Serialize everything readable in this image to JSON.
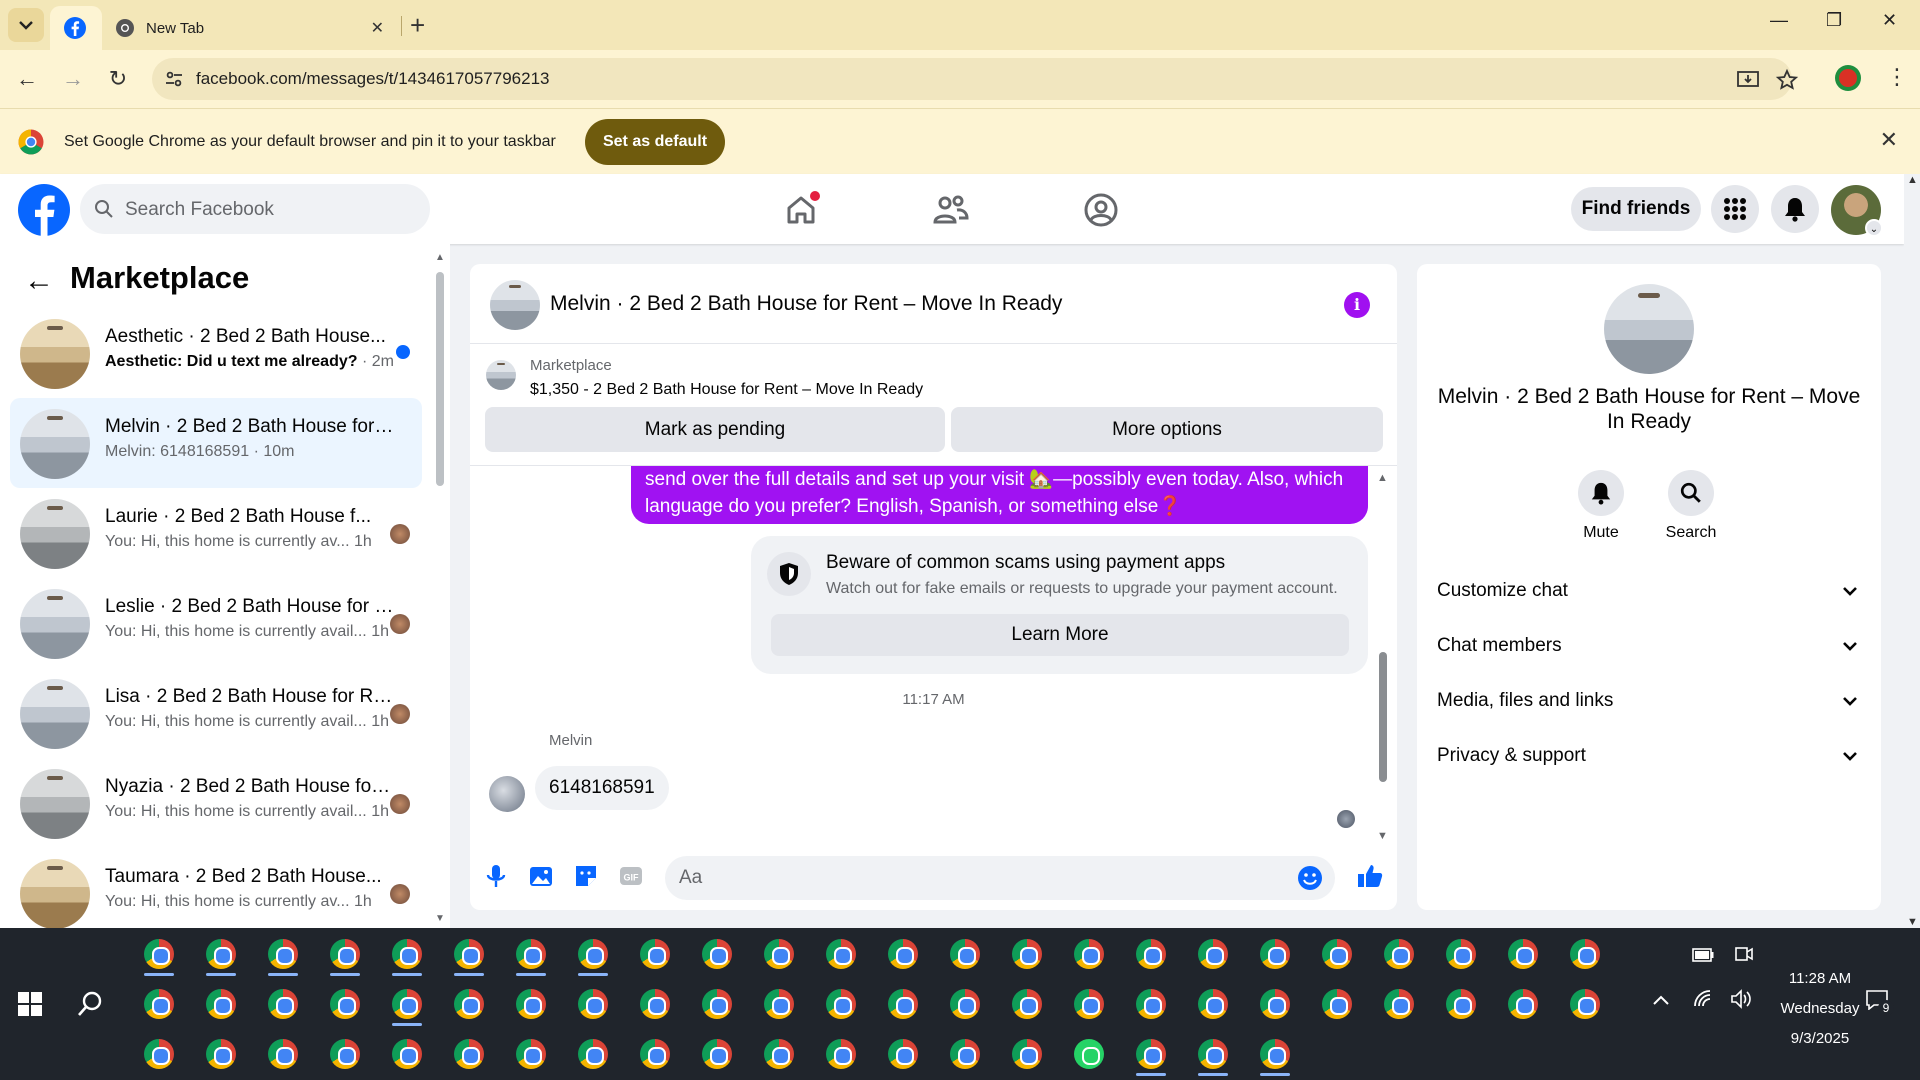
{
  "browser": {
    "tabs": [
      {
        "title": "",
        "icon": "facebook-icon",
        "active": true
      },
      {
        "title": "New Tab",
        "icon": "chrome-icon",
        "active": false
      }
    ],
    "url": "facebook.com/messages/t/1434617057796213",
    "infobar": {
      "message": "Set Google Chrome as your default browser and pin it to your taskbar",
      "button": "Set as default"
    }
  },
  "facebook": {
    "search_placeholder": "Search Facebook",
    "find_friends": "Find friends",
    "accent_color": "#a012f2",
    "brand_color": "#0866ff"
  },
  "marketplace": {
    "title": "Marketplace",
    "conversations": [
      {
        "name": "Aesthetic · 2 Bed 2 Bath House...",
        "snippet": "Aesthetic: Did u text me already?",
        "time": "· 2m",
        "unread": true,
        "photo": "warm"
      },
      {
        "name": "Melvin · 2 Bed 2 Bath House for ...",
        "snippet": "Melvin: 6148168591",
        "time": "· 10m",
        "selected": true,
        "photo": "default"
      },
      {
        "name": "Laurie · 2 Bed 2 Bath House f...",
        "snippet": "You: Hi, this home is currently av...",
        "time": "1h",
        "photo": "gray"
      },
      {
        "name": "Leslie · 2 Bed 2 Bath House for R...",
        "snippet": "You: Hi, this home is currently avail...",
        "time": "1h",
        "photo": "default"
      },
      {
        "name": "Lisa · 2 Bed 2 Bath House for Re...",
        "snippet": "You: Hi, this home is currently avail...",
        "time": "1h",
        "photo": "default"
      },
      {
        "name": "Nyazia · 2 Bed 2 Bath House for ...",
        "snippet": "You: Hi, this home is currently avail...",
        "time": "1h",
        "photo": "gray"
      },
      {
        "name": "Taumara · 2 Bed 2 Bath House...",
        "snippet": "You: Hi, this home is currently av...",
        "time": "1h",
        "photo": "warm"
      }
    ]
  },
  "chat": {
    "title": "Melvin · 2 Bed 2 Bath House for Rent – Move In Ready",
    "listing_source": "Marketplace",
    "listing_price": "$1,350 - 2 Bed 2 Bath House for Rent – Move In Ready",
    "mark_pending": "Mark as pending",
    "more_options": "More options",
    "outgoing_line1": "send over the full details and set up your visit 🏡—possibly even today. Also, which",
    "outgoing_line2": "language do you prefer? English, Spanish, or something else❓",
    "scam_title": "Beware of common scams using payment apps",
    "scam_text": "Watch out for fake emails or requests to upgrade your payment account.",
    "learn_more": "Learn More",
    "timestamp": "11:17 AM",
    "sender": "Melvin",
    "incoming": "6148168591",
    "input_placeholder": "Aa"
  },
  "details": {
    "title": "Melvin · 2 Bed 2 Bath House for Rent – Move In Ready",
    "mute": "Mute",
    "search": "Search",
    "sections": [
      "Customize chat",
      "Chat members",
      "Media, files and links",
      "Privacy & support"
    ]
  },
  "taskbar": {
    "time": "11:28 AM",
    "day": "Wednesday",
    "date": "9/3/2025",
    "notifications": "9"
  }
}
